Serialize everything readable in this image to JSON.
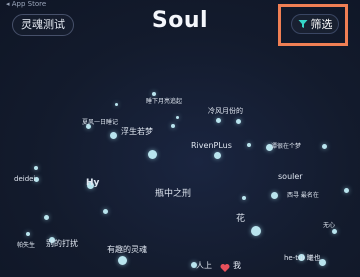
{
  "status_bar": {
    "back_text": "◂ App Store"
  },
  "header": {
    "left_button_label": "灵魂测试",
    "title": "Soul",
    "filter_label": "筛选"
  },
  "accent_colors": {
    "filter_icon": "#35d6c8",
    "highlight_box": "#f07f54",
    "dot": "#b9e4ee"
  },
  "star_map": {
    "labels": [
      {
        "id": "l0",
        "text": "睡下月亮追起"
      },
      {
        "id": "l1",
        "text": "冷风月份的"
      },
      {
        "id": "l2",
        "text": "夏风一日睡记"
      },
      {
        "id": "l3",
        "text": "浮生若梦"
      },
      {
        "id": "l4",
        "text": "RivenPLus"
      },
      {
        "id": "l5",
        "text": "谭很在个梦"
      },
      {
        "id": "l6",
        "text": "deidei"
      },
      {
        "id": "l7",
        "text": "Hy"
      },
      {
        "id": "l8",
        "text": "瓶中之刑"
      },
      {
        "id": "l9",
        "text": "souler"
      },
      {
        "id": "l10",
        "text": "西寻 最名在"
      },
      {
        "id": "l11",
        "text": "花"
      },
      {
        "id": "l12",
        "text": "无心"
      },
      {
        "id": "l13",
        "text": "帕失生"
      },
      {
        "id": "l14",
        "text": "别的打扰"
      },
      {
        "id": "l15",
        "text": "有趣的灵魂"
      },
      {
        "id": "l16",
        "text": "he-tui 曦也"
      },
      {
        "id": "l17",
        "text": "人上"
      },
      {
        "id": "l18",
        "text": "我"
      }
    ]
  }
}
